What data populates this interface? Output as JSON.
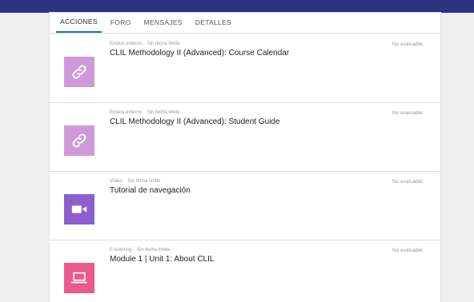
{
  "tabs": [
    {
      "label": "ACCIONES",
      "active": true
    },
    {
      "label": "FORO",
      "active": false
    },
    {
      "label": "MENSAJES",
      "active": false
    },
    {
      "label": "DETALLES",
      "active": false
    }
  ],
  "items": [
    {
      "type": "Enlace externo",
      "deadline": "Sin fecha límite",
      "title": "CLIL Methodology II (Advanced): Course Calendar",
      "grade": "No evaluable",
      "icon": "link-icon",
      "color": "#cf9ad8"
    },
    {
      "type": "Enlace externo",
      "deadline": "Sin fecha límite",
      "title": "CLIL Methodology II (Advanced): Student Guide",
      "grade": "No evaluable",
      "icon": "link-icon",
      "color": "#cf9ad8"
    },
    {
      "type": "Vídeo",
      "deadline": "Sin fecha límite",
      "title": "Tutorial de navegación",
      "grade": "No evaluable",
      "icon": "video-camera-icon",
      "color": "#8c5fcf"
    },
    {
      "type": "E-learning",
      "deadline": "Sin fecha límite",
      "title": "Module 1 | Unit 1: About CLIL",
      "grade": "No evaluable",
      "icon": "laptop-icon",
      "color": "#ea5a8c"
    }
  ],
  "colors": {
    "topbar": "#2c3380",
    "tab_accent": "#1a73c9"
  }
}
